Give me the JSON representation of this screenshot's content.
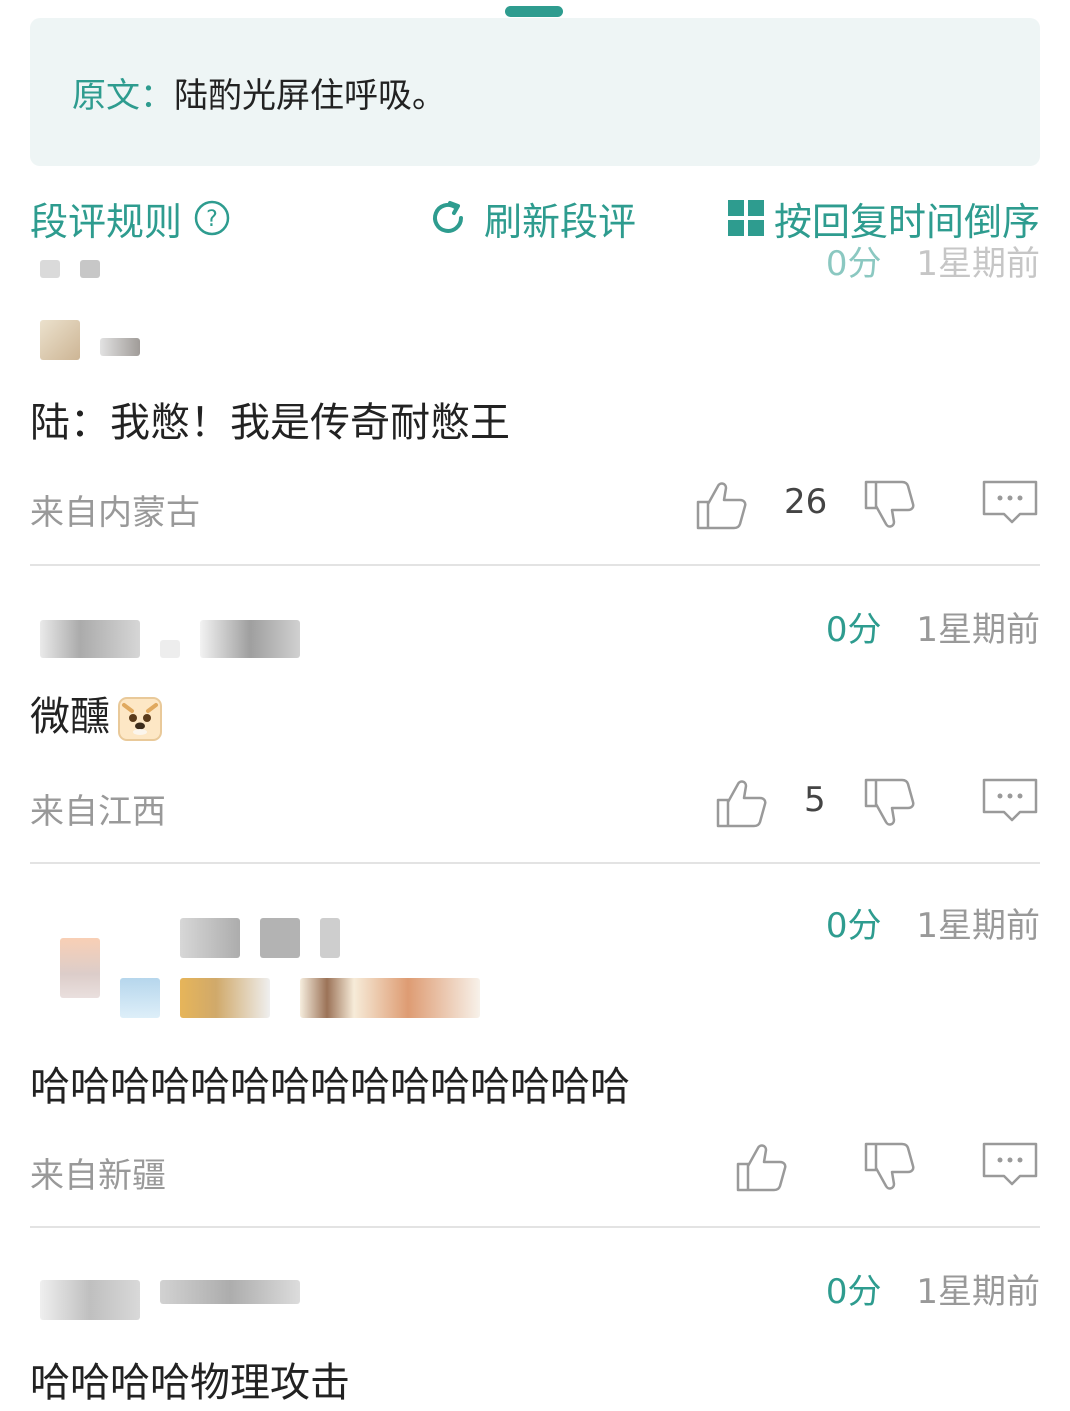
{
  "quote": {
    "label": "原文：",
    "text": "陆酌光屏住呼吸。"
  },
  "toolbar": {
    "rules_label": "段评规则",
    "refresh_label": "刷新段评",
    "sort_label": "按回复时间倒序"
  },
  "accent_color": "#2e9c8f",
  "comments": [
    {
      "score": "0分",
      "time": "1星期前",
      "text": "陆：我憋！我是传奇耐憋王",
      "location": "来自内蒙古",
      "likes": "26"
    },
    {
      "score": "0分",
      "time": "1星期前",
      "text": "微醺",
      "emoji": "dog-face-emoji",
      "location": "来自江西",
      "likes": "5"
    },
    {
      "score": "0分",
      "time": "1星期前",
      "text": "哈哈哈哈哈哈哈哈哈哈哈哈哈哈哈",
      "location": "来自新疆",
      "likes": ""
    },
    {
      "score": "0分",
      "time": "1星期前",
      "text": "哈哈哈哈物理攻击"
    }
  ]
}
